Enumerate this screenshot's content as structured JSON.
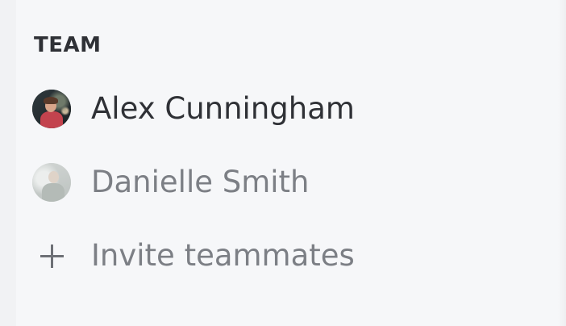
{
  "team": {
    "title": "TEAM",
    "members": [
      {
        "name": "Alex Cunningham",
        "state": "active"
      },
      {
        "name": "Danielle Smith",
        "state": "inactive"
      }
    ],
    "invite": {
      "label": "Invite teammates",
      "icon": "plus-icon"
    }
  },
  "colors": {
    "background": "#f6f7f9",
    "text_primary": "#2f3136",
    "text_muted": "#7c7f85"
  }
}
